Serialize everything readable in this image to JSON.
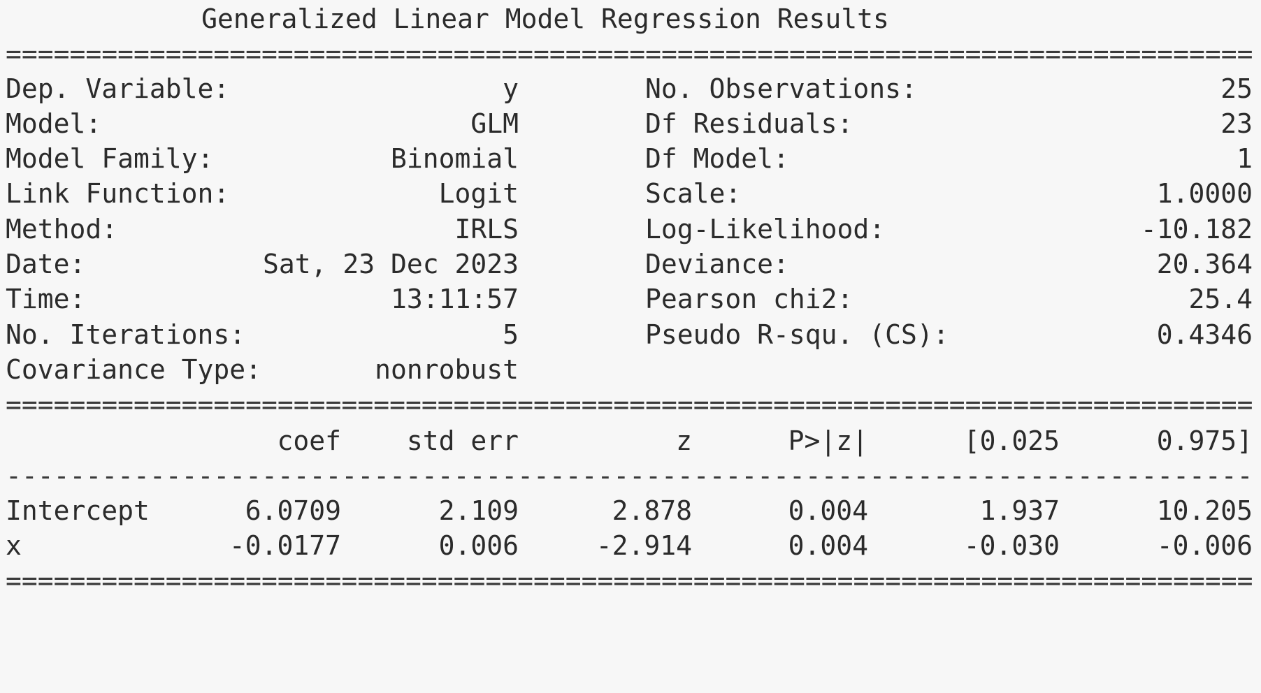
{
  "title": "Generalized Linear Model Regression Results",
  "rules": {
    "double": "==============================================================================",
    "single": "------------------------------------------------------------------------------"
  },
  "info_left": [
    {
      "label": "Dep. Variable:",
      "value": "y"
    },
    {
      "label": "Model:",
      "value": "GLM"
    },
    {
      "label": "Model Family:",
      "value": "Binomial"
    },
    {
      "label": "Link Function:",
      "value": "Logit"
    },
    {
      "label": "Method:",
      "value": "IRLS"
    },
    {
      "label": "Date:",
      "value": "Sat, 23 Dec 2023"
    },
    {
      "label": "Time:",
      "value": "13:11:57"
    },
    {
      "label": "No. Iterations:",
      "value": "5"
    },
    {
      "label": "Covariance Type:",
      "value": "nonrobust"
    }
  ],
  "info_right": [
    {
      "label": "No. Observations:",
      "value": "25"
    },
    {
      "label": "Df Residuals:",
      "value": "23"
    },
    {
      "label": "Df Model:",
      "value": "1"
    },
    {
      "label": "Scale:",
      "value": "1.0000"
    },
    {
      "label": "Log-Likelihood:",
      "value": "-10.182"
    },
    {
      "label": "Deviance:",
      "value": "20.364"
    },
    {
      "label": "Pearson chi2:",
      "value": "25.4"
    },
    {
      "label": "Pseudo R-squ. (CS):",
      "value": "0.4346"
    }
  ],
  "coef_table": {
    "headers": [
      "coef",
      "std err",
      "z",
      "P>|z|",
      "[0.025",
      "0.975]"
    ],
    "rows": [
      {
        "name": "Intercept",
        "cells": [
          "6.0709",
          "2.109",
          "2.878",
          "0.004",
          "1.937",
          "10.205"
        ]
      },
      {
        "name": "x",
        "cells": [
          "-0.0177",
          "0.006",
          "-2.914",
          "0.004",
          "-0.030",
          "-0.006"
        ]
      }
    ]
  }
}
